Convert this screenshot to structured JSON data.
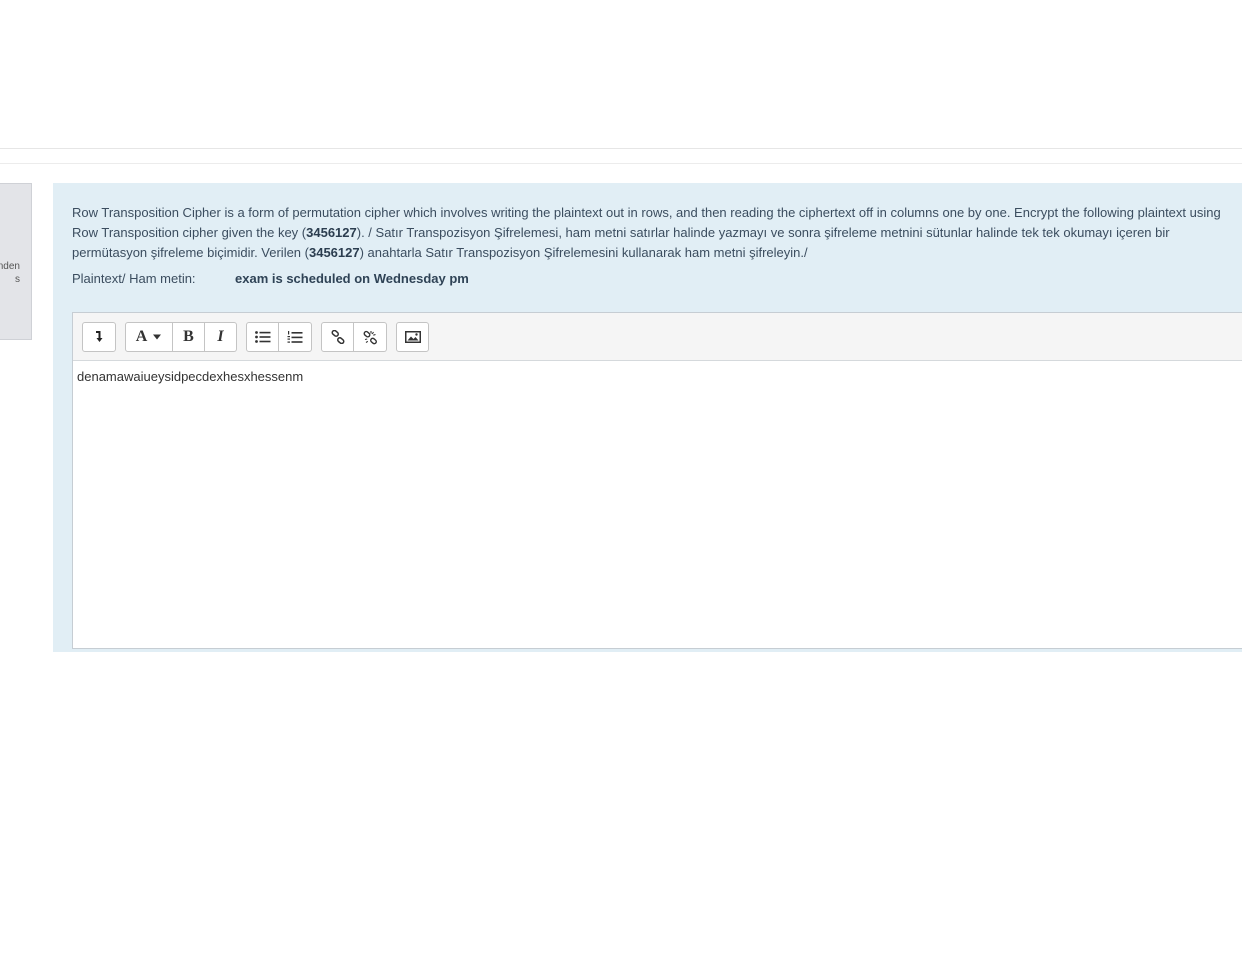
{
  "question_info": {
    "line1": "nden",
    "line2": "s"
  },
  "question": {
    "text_part1": "Row Transposition Cipher is a form of permutation cipher which involves writing the plaintext out in rows, and then reading the ciphertext off in columns one by one. Encrypt the following plaintext using Row Transposition cipher given the key (",
    "key1": "3456127",
    "text_part2": "). / Satır Transpozisyon Şifrelemesi, ham metni satırlar halinde yazmayı ve sonra şifreleme metnini sütunlar halinde tek tek okumayı içeren bir permütasyon şifreleme biçimidir. Verilen (",
    "key2": "3456127",
    "text_part3": ") anahtarla Satır Transpozisyon Şifrelemesini kullanarak ham metni şifreleyin./",
    "plaintext_label": "Plaintext/ Ham metin:",
    "plaintext_value": "exam is scheduled on Wednesday pm"
  },
  "editor": {
    "content": "denamawaiueysidpecdexhesxhessenm",
    "toolbar": {
      "collapse_icon": "arrow-collapse-icon",
      "font_label": "A",
      "bold_label": "B",
      "italic_label": "I",
      "icons": [
        "unordered-list-icon",
        "ordered-list-icon",
        "link-icon",
        "unlink-icon",
        "image-icon"
      ]
    }
  }
}
